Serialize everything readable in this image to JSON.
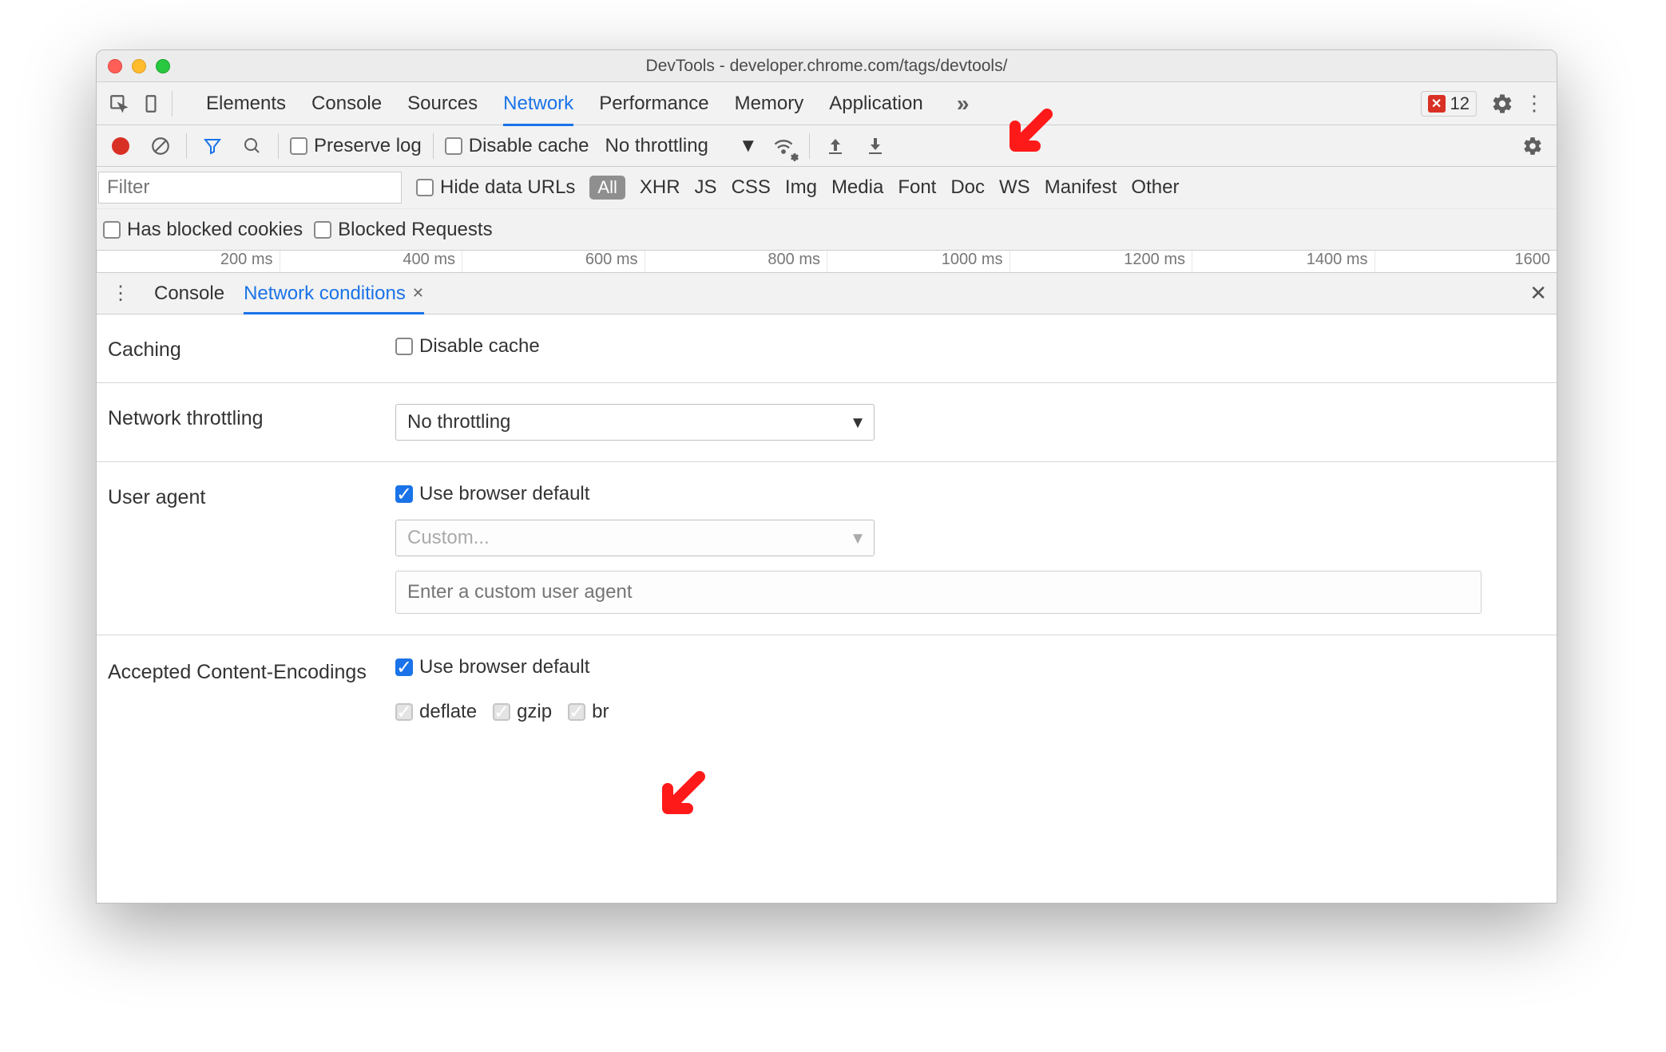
{
  "window": {
    "title": "DevTools - developer.chrome.com/tags/devtools/"
  },
  "maintabs": {
    "items": [
      "Elements",
      "Console",
      "Sources",
      "Network",
      "Performance",
      "Memory",
      "Application"
    ],
    "activeIndex": 3,
    "errorCount": "12"
  },
  "toolbar": {
    "preserveLog": "Preserve log",
    "disableCache": "Disable cache",
    "throttling": "No throttling"
  },
  "filterRow": {
    "placeholder": "Filter",
    "hideDataUrls": "Hide data URLs",
    "allPill": "All",
    "types": [
      "XHR",
      "JS",
      "CSS",
      "Img",
      "Media",
      "Font",
      "Doc",
      "WS",
      "Manifest",
      "Other"
    ],
    "hasBlockedCookies": "Has blocked cookies",
    "blockedRequests": "Blocked Requests"
  },
  "timeline": [
    "200 ms",
    "400 ms",
    "600 ms",
    "800 ms",
    "1000 ms",
    "1200 ms",
    "1400 ms",
    "1600"
  ],
  "drawer": {
    "tab1": "Console",
    "tab2": "Network conditions"
  },
  "sections": {
    "caching": {
      "label": "Caching",
      "checkbox": "Disable cache"
    },
    "throttling": {
      "label": "Network throttling",
      "value": "No throttling"
    },
    "userAgent": {
      "label": "User agent",
      "useDefault": "Use browser default",
      "customSelect": "Custom...",
      "customInputPlaceholder": "Enter a custom user agent"
    },
    "encodings": {
      "label": "Accepted Content-Encodings",
      "useDefault": "Use browser default",
      "opts": [
        "deflate",
        "gzip",
        "br"
      ]
    }
  }
}
